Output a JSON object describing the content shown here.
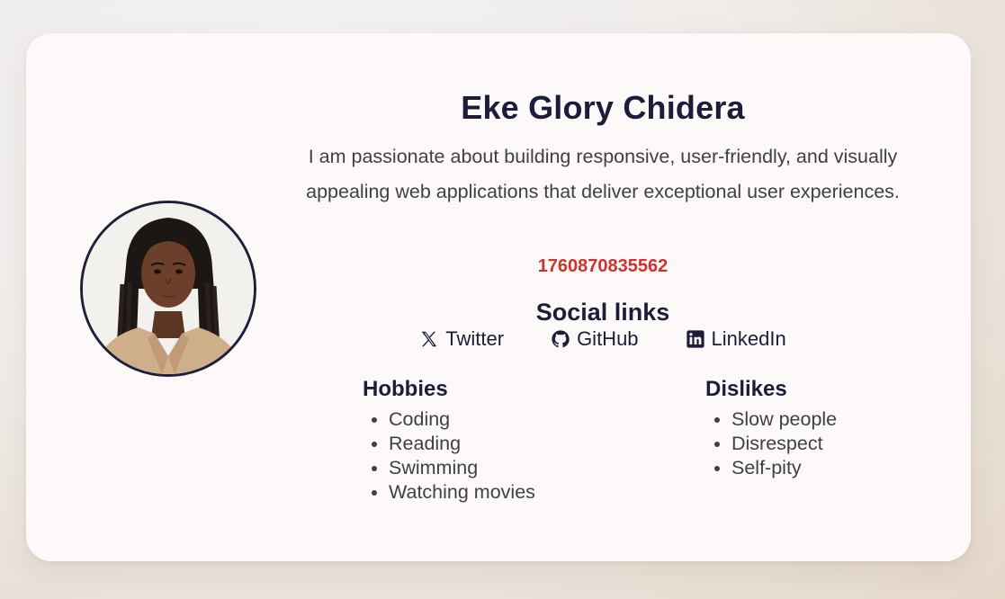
{
  "profile": {
    "name": "Eke Glory Chidera",
    "bio": "I am passionate about building responsive, user-friendly, and visually appealing web applications that deliver exceptional user experiences.",
    "timestamp": "1760870835562",
    "avatar_alt": "avatar"
  },
  "social": {
    "title": "Social links",
    "links": [
      {
        "label": "Twitter",
        "icon": "x-twitter-icon"
      },
      {
        "label": "GitHub",
        "icon": "github-icon"
      },
      {
        "label": "LinkedIn",
        "icon": "linkedin-icon"
      }
    ]
  },
  "hobbies": {
    "title": "Hobbies",
    "items": [
      "Coding",
      "Reading",
      "Swimming",
      "Watching movies"
    ]
  },
  "dislikes": {
    "title": "Dislikes",
    "items": [
      "Slow people",
      "Disrespect",
      "Self-pity"
    ]
  },
  "colors": {
    "heading": "#1b1d3a",
    "body_text": "#3f3f46",
    "timestamp": "#d0312d",
    "card_bg": "#fdf9f8"
  }
}
